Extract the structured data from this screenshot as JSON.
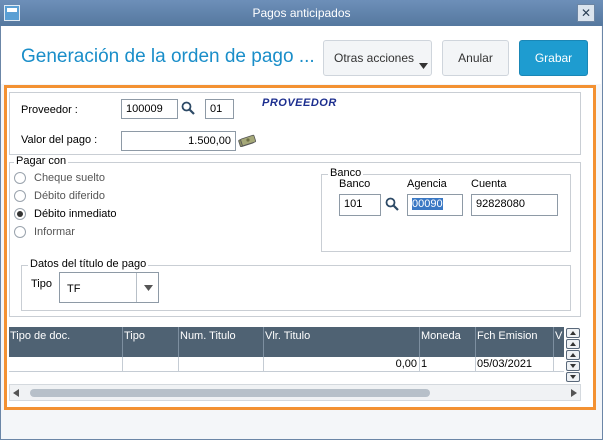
{
  "window": {
    "title": "Pagos anticipados",
    "close_glyph": "✕"
  },
  "header": {
    "title": "Generación de la orden de pago ...",
    "buttons": {
      "more_actions": "Otras acciones",
      "cancel": "Anular",
      "save": "Grabar"
    }
  },
  "supplier": {
    "label": "Proveedor :",
    "code": "100009",
    "branch": "01",
    "name": "PROVEEDOR",
    "amount_label": "Valor del pago :",
    "amount": "1.500,00"
  },
  "payment_method": {
    "group_title": "Pagar con",
    "options": [
      {
        "label": "Cheque suelto",
        "selected": false
      },
      {
        "label": "Débito diferido",
        "selected": false
      },
      {
        "label": "Débito inmediato",
        "selected": true
      },
      {
        "label": "Informar",
        "selected": false
      }
    ]
  },
  "bank": {
    "group_title": "Banco",
    "bank_label": "Banco",
    "bank_value": "101",
    "agency_label": "Agencia",
    "agency_value": "00090",
    "account_label": "Cuenta",
    "account_value": "92828080"
  },
  "title_data": {
    "group_title": "Datos del título de pago",
    "type_label": "Tipo",
    "type_value": "TF"
  },
  "grid": {
    "columns": [
      "Tipo de doc.",
      "Tipo",
      "Num. Titulo",
      "Vlr. Titulo",
      "Moneda",
      "Fch Emision",
      "V"
    ],
    "rows": [
      [
        "",
        "",
        "",
        "0,00",
        "1",
        "05/03/2021",
        ""
      ]
    ]
  },
  "icons": {
    "search": "magnifier-icon",
    "money": "money-icon",
    "select_arrow": "chevron-down-icon"
  }
}
